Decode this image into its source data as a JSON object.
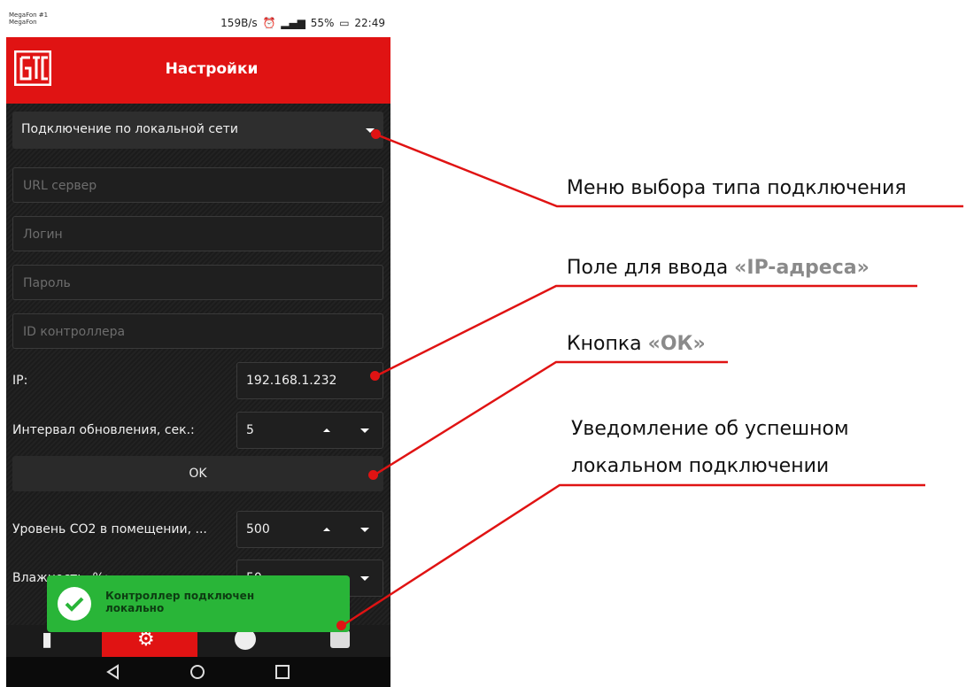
{
  "status_bar": {
    "carrier1": "MegaFon #1",
    "carrier2": "MegaFon",
    "speed": "159B/s",
    "battery": "55%",
    "time": "22:49"
  },
  "app_bar": {
    "title": "Настройки"
  },
  "settings": {
    "connection_type": "Подключение по локальной сети",
    "url_placeholder": "URL сервер",
    "login_placeholder": "Логин",
    "password_placeholder": "Пароль",
    "controller_id_placeholder": "ID контроллера",
    "ip_label": "IP:",
    "ip_value": "192.168.1.232",
    "interval_label": "Интервал обновления, сек.:",
    "interval_value": "5",
    "ok_label": "OK",
    "co2_label": "Уровень CO2 в помещении, ...",
    "co2_value": "500",
    "humidity_label": "Влажность, %:",
    "humidity_value": "50"
  },
  "toast": {
    "line1": "Контроллер подключен",
    "line2": "локально"
  },
  "annotations": {
    "menu": "Меню выбора типа подключения",
    "ip_field_prefix": "Поле для ввода ",
    "ip_field_highlight": "«IP-адреса»",
    "ok_prefix": "Кнопка ",
    "ok_highlight": "«ОК»",
    "notify_line1": "Уведомление об успешном",
    "notify_line2": "локальном подключении"
  },
  "colors": {
    "accent": "#e01313",
    "toast": "#29b538",
    "annotation_line": "#e01313"
  }
}
